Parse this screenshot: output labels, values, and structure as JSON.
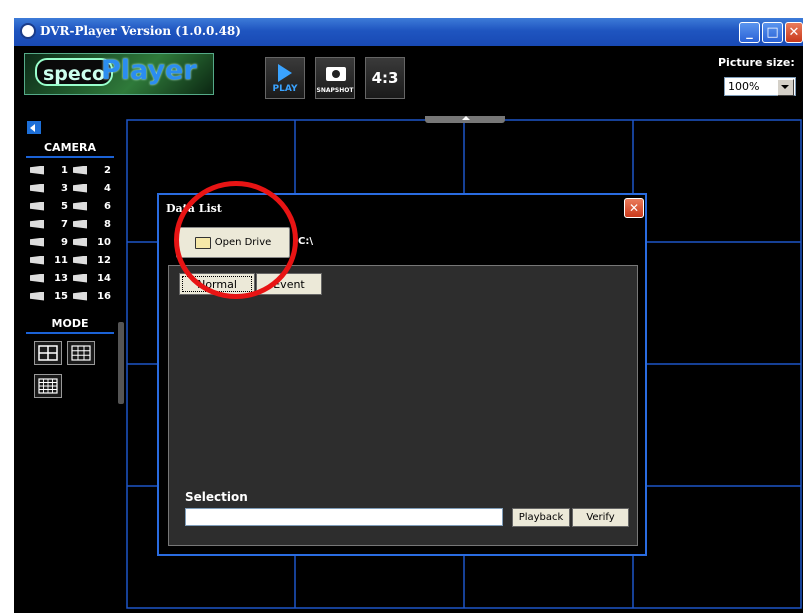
{
  "window": {
    "title": "DVR-Player Version (1.0.0.48)",
    "controls": [
      "minimize",
      "maximize",
      "close"
    ]
  },
  "toolbar": {
    "logo": "specoPlayer",
    "play_label": "PLAY",
    "snapshot_label": "SNAPSHOT",
    "aspect_label": "4:3",
    "picture_size_label": "Picture size:",
    "picture_size_value": "100%"
  },
  "sidebar": {
    "camera_heading": "CAMERA",
    "cameras": [
      "1",
      "2",
      "3",
      "4",
      "5",
      "6",
      "7",
      "8",
      "9",
      "10",
      "11",
      "12",
      "13",
      "14",
      "15",
      "16"
    ],
    "mode_heading": "MODE",
    "modes": [
      "quad",
      "3x3",
      "4x4"
    ]
  },
  "dialog": {
    "title": "Data List",
    "open_drive_label": "Open Drive",
    "drive_path": "C:\\",
    "tabs": [
      {
        "label": "Normal",
        "active": true
      },
      {
        "label": "Event",
        "active": false
      }
    ],
    "selection_label": "Selection",
    "selection_value": "",
    "playback_label": "Playback",
    "verify_label": "Verify"
  },
  "colors": {
    "accent_blue": "#1b62d6",
    "grid_line": "#1e56c8",
    "highlight_red": "#e81414"
  }
}
